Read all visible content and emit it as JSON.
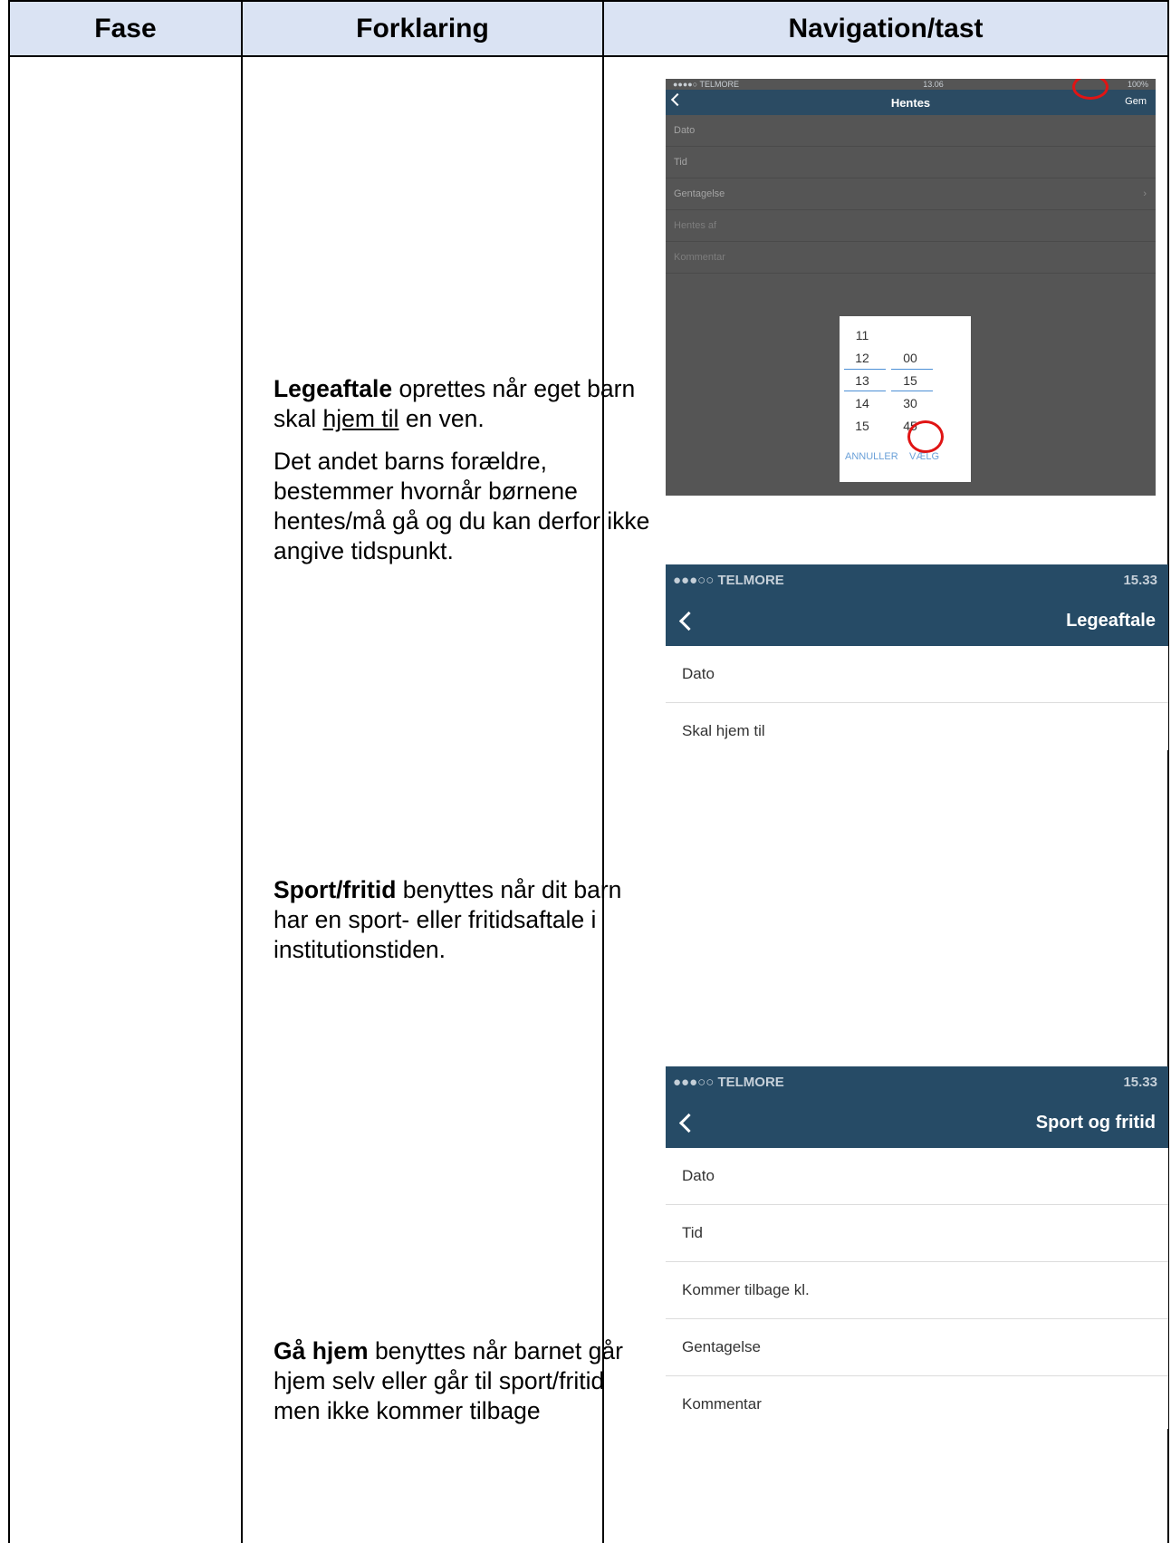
{
  "table": {
    "headers": [
      "Fase",
      "Forklaring",
      "Navigation/tast"
    ]
  },
  "explanations": [
    {
      "bold": "Legeaftale",
      "text1": " oprettes når eget barn skal ",
      "underline": "hjem til",
      "text2": " en ven.",
      "para2": "Det andet barns forældre, bestemmer hvornår børnene hentes/må gå og du kan derfor ikke angive tidspunkt."
    },
    {
      "bold": "Sport/fritid",
      "text": " benyttes når dit barn har en sport- eller fritidsaftale i institutionstiden."
    },
    {
      "bold": "Gå hjem",
      "text": " benyttes når barnet går hjem selv eller går til sport/fritid men ikke kommer tilbage"
    }
  ],
  "screen_hentes": {
    "carrier": "●●●●○ TELMORE",
    "time": "13.06",
    "battery": "100%",
    "title": "Hentes",
    "save_label": "Gem",
    "rows": [
      "Dato",
      "Tid",
      "Gentagelse",
      "Hentes af",
      "Kommentar"
    ],
    "picker": {
      "hours": [
        "11",
        "12",
        "13",
        "14",
        "15"
      ],
      "minutes": [
        "00",
        "15",
        "30",
        "45"
      ],
      "cancel_label": "ANNULLER",
      "confirm_label": "VÆLG"
    }
  },
  "screen_legeaftale": {
    "carrier": "●●●○○ TELMORE",
    "time": "15.33",
    "title": "Legeaftale",
    "rows": [
      "Dato",
      "Skal hjem til"
    ]
  },
  "screen_sport": {
    "carrier": "●●●○○ TELMORE",
    "time": "15.33",
    "title": "Sport og fritid",
    "rows": [
      "Dato",
      "Tid",
      "Kommer tilbage kl.",
      "Gentagelse",
      "Kommentar"
    ]
  },
  "colors": {
    "header_bg": "#dae3f3",
    "nav_bar": "#264b66",
    "highlight_ring": "#e01414"
  }
}
